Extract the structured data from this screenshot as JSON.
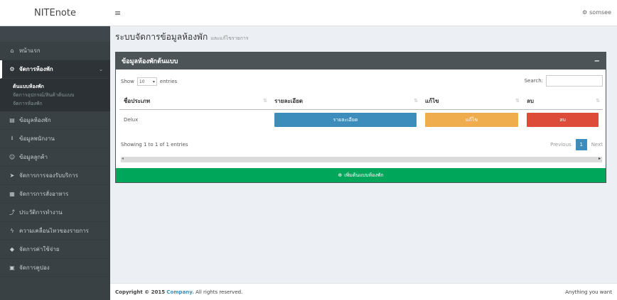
{
  "brand": "NITEnote",
  "user": "somsee",
  "sidebar": {
    "items": [
      {
        "icon": "home-icon",
        "glyph": "⌂",
        "label": "หน้าแรก"
      },
      {
        "icon": "gear-icon",
        "glyph": "⚙",
        "label": "จัดการห้องพัก",
        "active": true
      },
      {
        "icon": "list-icon",
        "glyph": "▤",
        "label": "ข้อมูลห้องพัก"
      },
      {
        "icon": "download-icon",
        "glyph": "⭳",
        "label": "ข้อมูลพนักงาน"
      },
      {
        "icon": "users-icon",
        "glyph": "☺",
        "label": "ข้อมูลลูกค้า"
      },
      {
        "icon": "send-icon",
        "glyph": "➤",
        "label": "จัดการการจองรับบริการ"
      },
      {
        "icon": "table-icon",
        "glyph": "▦",
        "label": "จัดการการสั่งอาหาร"
      },
      {
        "icon": "chart-icon",
        "glyph": "⤴",
        "label": "ประวัติการทำงาน"
      },
      {
        "icon": "bolt-icon",
        "glyph": "ϟ",
        "label": "ความเคลื่อนไหวของรายการ"
      },
      {
        "icon": "tag-icon",
        "glyph": "◆",
        "label": "จัดการค่าใช้จ่าย"
      },
      {
        "icon": "card-icon",
        "glyph": "▣",
        "label": "จัดการคูปอง"
      }
    ],
    "submenu": [
      "ต้นแบบห้องพัก",
      "จัดการอุปกรณ์/สินค้าต้นแบบ",
      "จัดการห้องพัก"
    ]
  },
  "page": {
    "title": "ระบบจัดการข้อมูลห้องพัก",
    "subtitle": "และแก้ไขรายการ"
  },
  "box": {
    "title": "ข้อมูลห้องพักต้นแบบ",
    "show_label": "Show",
    "entries_value": "10",
    "entries_label": "entries",
    "search_label": "Search:",
    "columns": [
      "ชื่อประเภท",
      "รายละเอียด",
      "แก้ไข",
      "ลบ"
    ],
    "rows": [
      {
        "name": "Delux",
        "detail_btn": "รายละเอียด",
        "edit_btn": "แก้ไข",
        "delete_btn": "ลบ"
      }
    ],
    "info": "Showing 1 to 1 of 1 entries",
    "paging": {
      "previous": "Previous",
      "current": "1",
      "next": "Next"
    },
    "add_button": "เพิ่มต้นแบบห้องพัก"
  },
  "footer": {
    "copyright": "Copyright © 2015",
    "company": "Company.",
    "rights": "All rights reserved.",
    "right_text": "Anything you want"
  }
}
